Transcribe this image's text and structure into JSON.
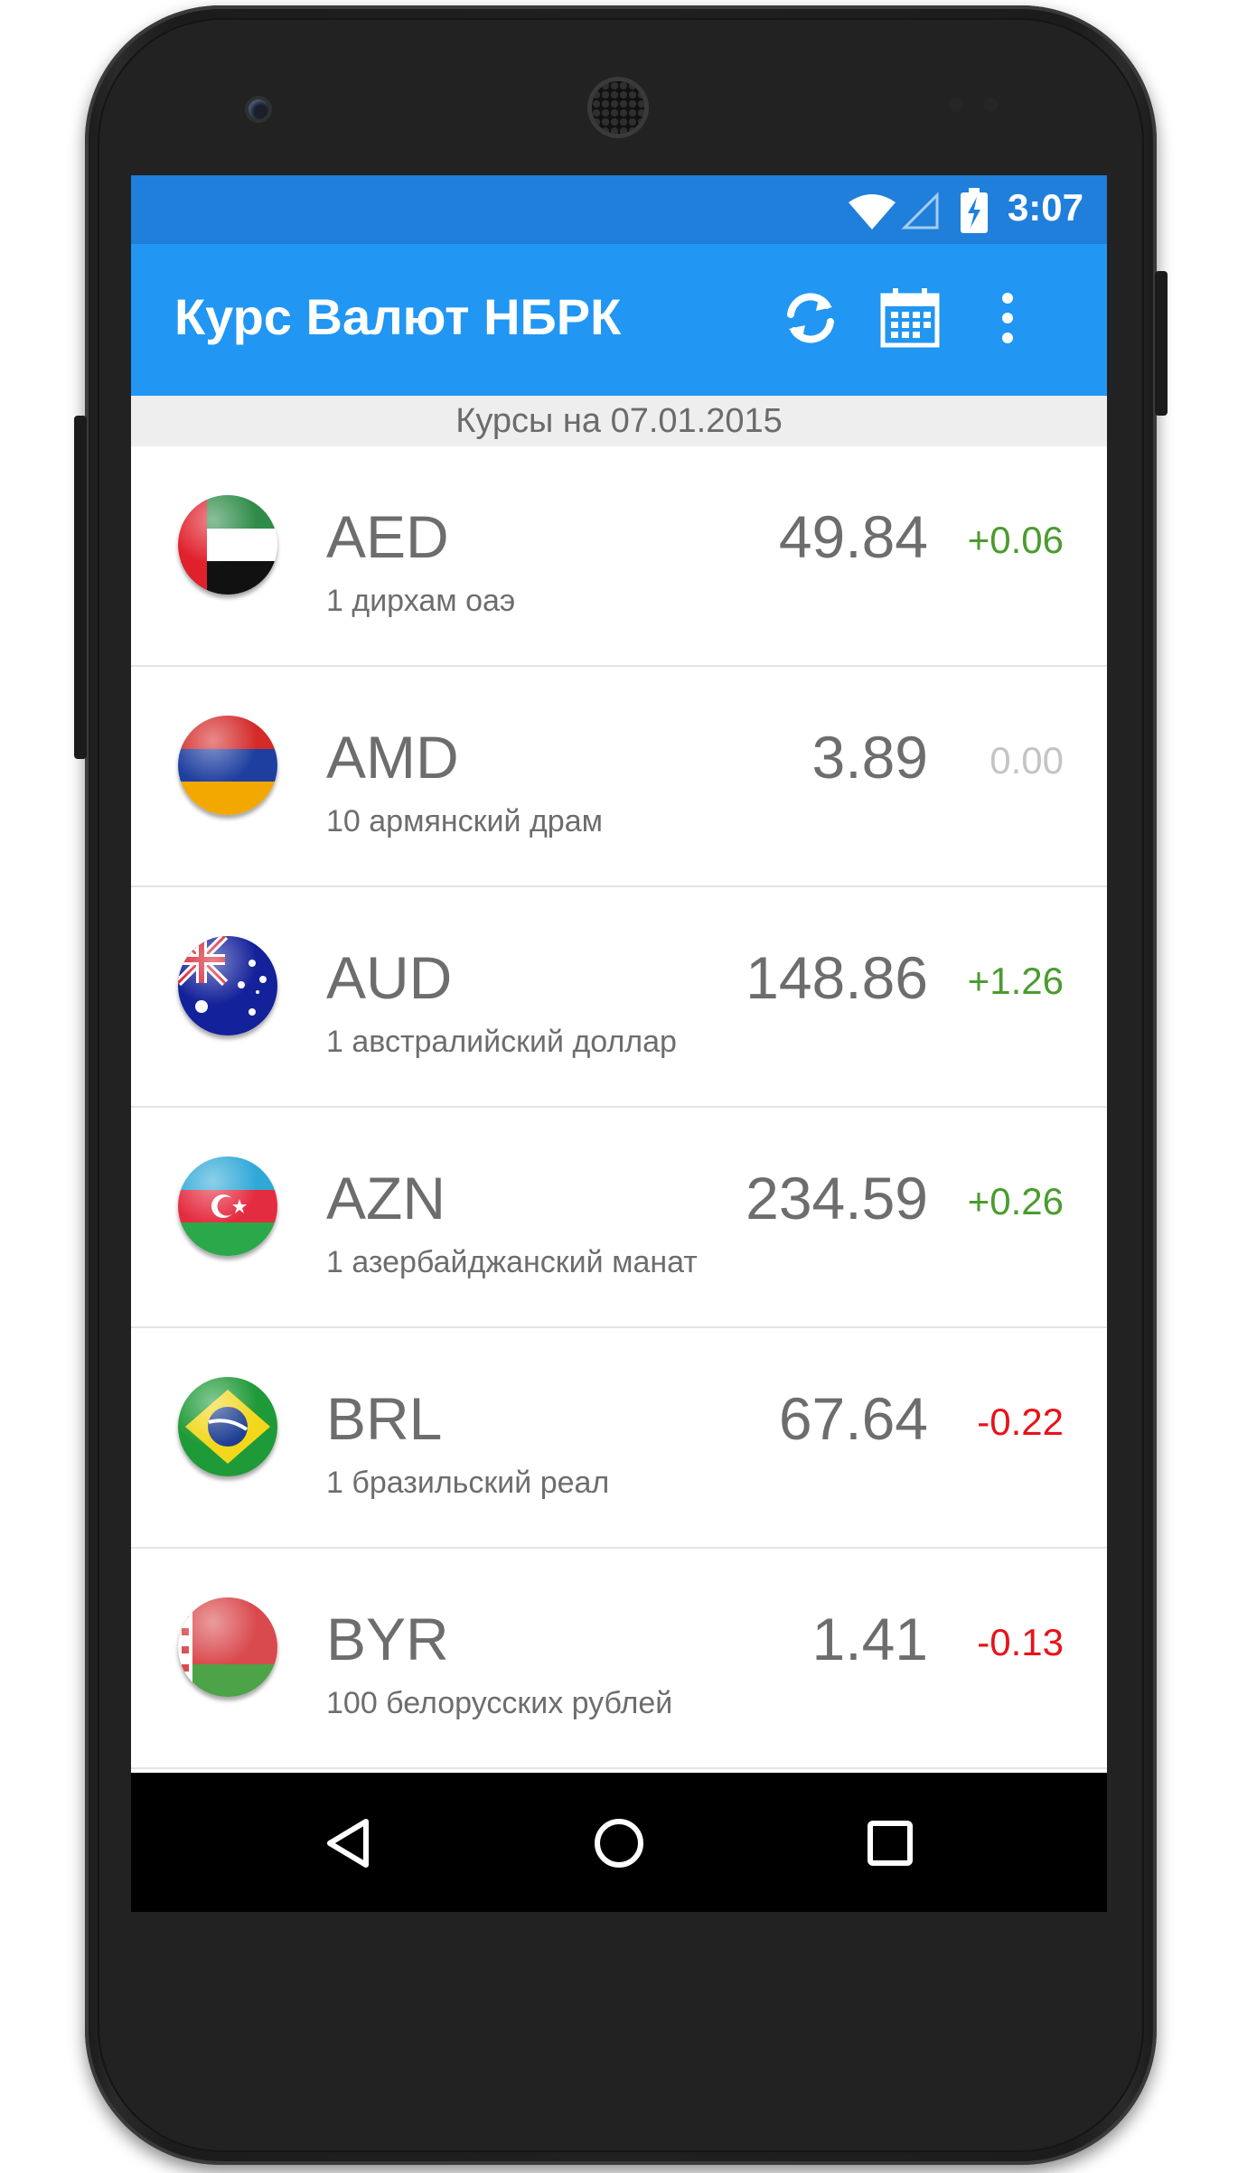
{
  "status_bar": {
    "time": "3:07"
  },
  "app_bar": {
    "title": "Курс Валют НБРК",
    "refresh_icon": "refresh-icon",
    "calendar_icon": "calendar-icon",
    "overflow_icon": "more-vert-icon"
  },
  "date_header": "Курсы на 07.01.2015",
  "currencies": [
    {
      "code": "AED",
      "name": "1 дирхам оаэ",
      "rate": "49.84",
      "change": "+0.06",
      "change_color": "#4a9c2f",
      "flag": "uae-flag"
    },
    {
      "code": "AMD",
      "name": "10 армянский драм",
      "rate": "3.89",
      "change": "0.00",
      "change_color": "#c4c4c4",
      "flag": "armenia-flag"
    },
    {
      "code": "AUD",
      "name": "1 австралийский доллар",
      "rate": "148.86",
      "change": "+1.26",
      "change_color": "#4a9c2f",
      "flag": "australia-flag"
    },
    {
      "code": "AZN",
      "name": "1 азербайджанский манат",
      "rate": "234.59",
      "change": "+0.26",
      "change_color": "#4a9c2f",
      "flag": "azerbaijan-flag"
    },
    {
      "code": "BRL",
      "name": "1 бразильский реал",
      "rate": "67.64",
      "change": "-0.22",
      "change_color": "#e8121a",
      "flag": "brazil-flag"
    },
    {
      "code": "BYR",
      "name": "100 белорусских рублей",
      "rate": "1.41",
      "change": "-0.13",
      "change_color": "#e8121a",
      "flag": "belarus-flag"
    }
  ],
  "colors": {
    "status_bar": "#1f7fdb",
    "app_bar": "#2196f3",
    "positive": "#4a9c2f",
    "negative": "#e8121a",
    "neutral": "#c4c4c4"
  },
  "nav_bar": {
    "back_icon": "back-icon",
    "home_icon": "home-icon",
    "recents_icon": "recents-icon"
  }
}
